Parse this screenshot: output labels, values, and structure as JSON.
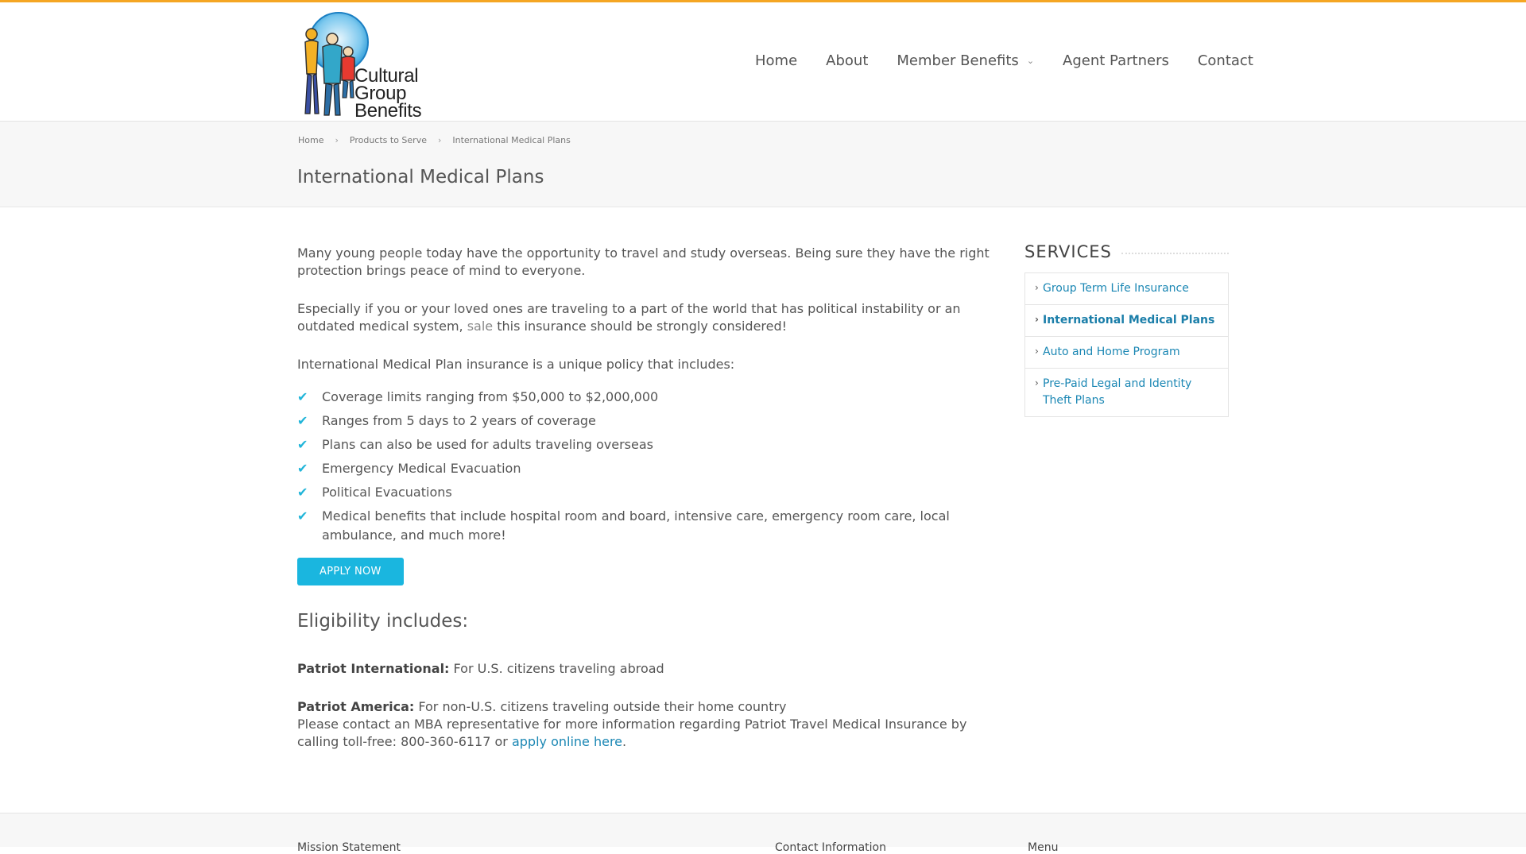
{
  "brand": {
    "logo_line1": "Cultural Group",
    "logo_line2": "Benefits",
    "accent_color": "#f5a623",
    "link_color": "#1b87b4",
    "button_color": "#1ab6df"
  },
  "nav": {
    "items": [
      {
        "label": "Home"
      },
      {
        "label": "About"
      },
      {
        "label": "Member Benefits",
        "has_dropdown": true
      },
      {
        "label": "Agent Partners"
      },
      {
        "label": "Contact"
      }
    ]
  },
  "breadcrumb": {
    "items": [
      "Home",
      "Products to Serve",
      "International Medical Plans"
    ],
    "separator": "›"
  },
  "page_title": "International Medical Plans",
  "content": {
    "p1": "Many young people today have the opportunity to travel and study overseas. Being sure they have the right protection brings peace of mind to everyone.",
    "p2_before": "Especially if you or your loved ones are traveling to a part of the world that has political instability or an outdated medical system, ",
    "p2_muted": "sale",
    "p2_after": " this insurance should be strongly considered!",
    "p3": "International Medical Plan insurance is a unique policy that includes:",
    "features": [
      "Coverage limits ranging from $50,000 to $2,000,000",
      "Ranges from 5 days to 2 years of coverage",
      "Plans can also be used for adults traveling overseas",
      "Emergency Medical Evacuation",
      "Political Evacuations",
      "Medical benefits that include hospital room and board, intensive care, emergency room care, local ambulance, and much more!"
    ],
    "apply_button": "APPLY NOW",
    "eligibility_title": "Eligibility includes:",
    "patriot_intl_label": "Patriot International:",
    "patriot_intl_text": " For U.S. citizens traveling abroad",
    "patriot_america_label": "Patriot America:",
    "patriot_america_text": " For non-U.S. citizens traveling outside their home country",
    "contact_text": "Please contact an MBA representative for more information regarding Patriot Travel Medical Insurance by calling toll-free: 800-360-6117 or ",
    "contact_link": "apply online here",
    "contact_end": "."
  },
  "sidebar": {
    "title": "SERVICES",
    "items": [
      {
        "label": "Group Term Life Insurance",
        "active": false
      },
      {
        "label": "International Medical Plans",
        "active": true
      },
      {
        "label": "Auto and Home Program",
        "active": false
      },
      {
        "label": "Pre-Paid Legal and Identity Theft Plans",
        "active": false
      }
    ]
  },
  "footer": {
    "col1": "Mission Statement",
    "col2": "Contact Information",
    "col3": "Menu"
  },
  "icons": {
    "check": "check-icon",
    "chevron": "chevron-right-icon",
    "caret": "chevron-down-icon"
  }
}
